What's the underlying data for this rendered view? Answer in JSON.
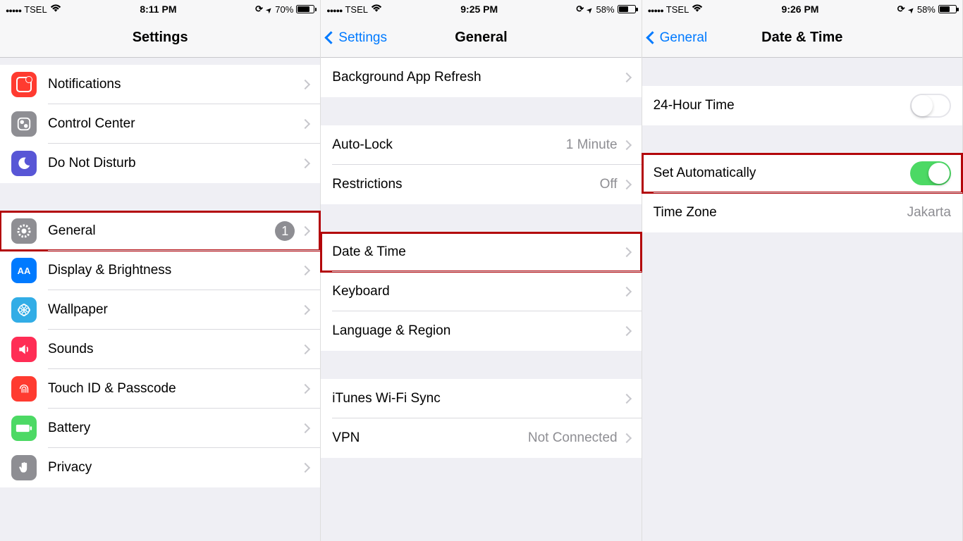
{
  "screen1": {
    "status": {
      "carrier": "TSEL",
      "time": "8:11 PM",
      "battery_pct": "70%",
      "battery_fill": 70
    },
    "nav": {
      "title": "Settings"
    },
    "rows": {
      "notifications": "Notifications",
      "control_center": "Control Center",
      "dnd": "Do Not Disturb",
      "general": "General",
      "general_badge": "1",
      "display": "Display & Brightness",
      "wallpaper": "Wallpaper",
      "sounds": "Sounds",
      "touchid": "Touch ID & Passcode",
      "battery": "Battery",
      "privacy": "Privacy"
    }
  },
  "screen2": {
    "status": {
      "carrier": "TSEL",
      "time": "9:25 PM",
      "battery_pct": "58%",
      "battery_fill": 58
    },
    "nav": {
      "back": "Settings",
      "title": "General"
    },
    "rows": {
      "bg_refresh": "Background App Refresh",
      "autolock": "Auto-Lock",
      "autolock_val": "1 Minute",
      "restrictions": "Restrictions",
      "restrictions_val": "Off",
      "datetime": "Date & Time",
      "keyboard": "Keyboard",
      "language": "Language & Region",
      "itunes": "iTunes Wi-Fi Sync",
      "vpn": "VPN",
      "vpn_val": "Not Connected"
    }
  },
  "screen3": {
    "status": {
      "carrier": "TSEL",
      "time": "9:26 PM",
      "battery_pct": "58%",
      "battery_fill": 58
    },
    "nav": {
      "back": "General",
      "title": "Date & Time"
    },
    "rows": {
      "h24": "24-Hour Time",
      "setauto": "Set Automatically",
      "timezone": "Time Zone",
      "timezone_val": "Jakarta"
    }
  }
}
